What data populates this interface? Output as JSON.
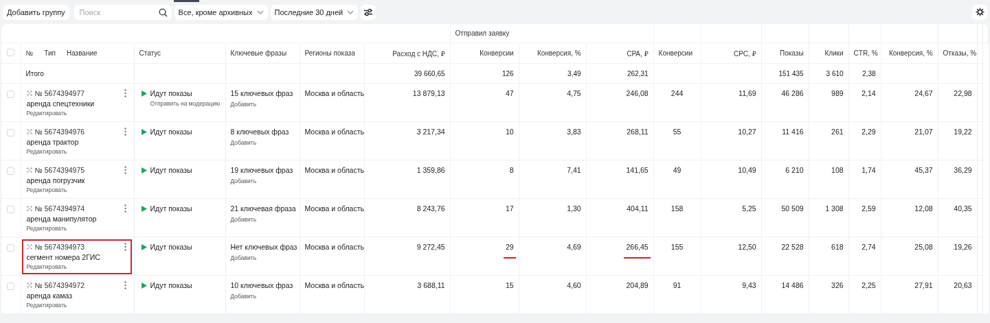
{
  "toolbar": {
    "add_button": "Добавить группу",
    "search": {
      "placeholder": "Поиск"
    },
    "filters": [
      {
        "label": "Все, кроме архивных"
      },
      {
        "label": "Последние 30 дней"
      }
    ]
  },
  "table": {
    "group_header": {
      "label": "Отправил заявку"
    },
    "select_all": {
      "checked": false
    },
    "name_header": {
      "number": "№",
      "type": "Тип",
      "name": "Название"
    },
    "columns": [
      {
        "label": "Статус"
      },
      {
        "label": "Ключевые фразы"
      },
      {
        "label": "Регионы показа"
      },
      {
        "label": "Расход с НДС, ₽",
        "total": "39 660,65"
      },
      {
        "label": "Конверсии",
        "total": "126"
      },
      {
        "label": "Конверсия, %",
        "total": "3,49"
      },
      {
        "label": "CPA, ₽",
        "total": "262,31"
      },
      {
        "label": "Конверсии"
      },
      {
        "label": "CPC, ₽"
      },
      {
        "label": "Показы",
        "total": "151 435"
      },
      {
        "label": "Клики",
        "total": "3 610"
      },
      {
        "label": "CTR, %",
        "total": "2,38"
      },
      {
        "label": "Конверсия, %"
      },
      {
        "label": "Отказы, %"
      }
    ],
    "total_label": "Итого",
    "rows": [
      {
        "checked": false,
        "highlighted": false,
        "number": "№ 5674394977",
        "name": "аренда спецтехники",
        "edit": "Редактировать",
        "status": "Идут показы",
        "status_action": "Отправить на модерацию",
        "keywords": "15 ключевых фраз",
        "add": "Добавить",
        "region": "Москва и область",
        "values": [
          {
            "text": "13 879,13",
            "underlined": false
          },
          {
            "text": "47",
            "underlined": false
          },
          {
            "text": "4,75",
            "underlined": false
          },
          {
            "text": "246,08",
            "underlined": false
          },
          {
            "text": "244",
            "underlined": false
          },
          {
            "text": "11,69",
            "underlined": false
          },
          {
            "text": "46 286",
            "underlined": false
          },
          {
            "text": "989",
            "underlined": false
          },
          {
            "text": "2,14",
            "underlined": false
          },
          {
            "text": "24,67",
            "underlined": false
          },
          {
            "text": "22,98",
            "underlined": false
          }
        ]
      },
      {
        "checked": false,
        "highlighted": false,
        "number": "№ 5674394976",
        "name": "аренда трактор",
        "edit": "Редактировать",
        "status": "Идут показы",
        "keywords": "8 ключевых фраз",
        "add": "Добавить",
        "region": "Москва и область",
        "values": [
          {
            "text": "3 217,34",
            "underlined": false
          },
          {
            "text": "10",
            "underlined": false
          },
          {
            "text": "3,83",
            "underlined": false
          },
          {
            "text": "268,11",
            "underlined": false
          },
          {
            "text": "55",
            "underlined": false
          },
          {
            "text": "10,27",
            "underlined": false
          },
          {
            "text": "11 416",
            "underlined": false
          },
          {
            "text": "261",
            "underlined": false
          },
          {
            "text": "2,29",
            "underlined": false
          },
          {
            "text": "21,07",
            "underlined": false
          },
          {
            "text": "19,22",
            "underlined": false
          }
        ]
      },
      {
        "checked": false,
        "highlighted": false,
        "number": "№ 5674394975",
        "name": "аренда погрузчик",
        "edit": "Редактировать",
        "status": "Идут показы",
        "keywords": "19 ключевых фраз",
        "add": "Добавить",
        "region": "Москва и область",
        "values": [
          {
            "text": "1 359,86",
            "underlined": false
          },
          {
            "text": "8",
            "underlined": false
          },
          {
            "text": "7,41",
            "underlined": false
          },
          {
            "text": "141,65",
            "underlined": false
          },
          {
            "text": "49",
            "underlined": false
          },
          {
            "text": "10,49",
            "underlined": false
          },
          {
            "text": "6 210",
            "underlined": false
          },
          {
            "text": "108",
            "underlined": false
          },
          {
            "text": "1,74",
            "underlined": false
          },
          {
            "text": "45,37",
            "underlined": false
          },
          {
            "text": "36,29",
            "underlined": false
          }
        ]
      },
      {
        "checked": false,
        "highlighted": false,
        "number": "№ 5674394974",
        "name": "аренда манипулятор",
        "edit": "Редактировать",
        "status": "Идут показы",
        "keywords": "21 ключевая фраза",
        "add": "Добавить",
        "region": "Москва и область",
        "values": [
          {
            "text": "8 243,76",
            "underlined": false
          },
          {
            "text": "17",
            "underlined": false
          },
          {
            "text": "1,30",
            "underlined": false
          },
          {
            "text": "404,11",
            "underlined": false
          },
          {
            "text": "158",
            "underlined": false
          },
          {
            "text": "5,25",
            "underlined": false
          },
          {
            "text": "50 509",
            "underlined": false
          },
          {
            "text": "1 308",
            "underlined": false
          },
          {
            "text": "2,59",
            "underlined": false
          },
          {
            "text": "12,08",
            "underlined": false
          },
          {
            "text": "40,35",
            "underlined": false
          }
        ]
      },
      {
        "checked": false,
        "highlighted": true,
        "number": "№ 5674394973",
        "name": "сегмент номера 2ГИС",
        "edit": "Редактировать",
        "status": "Идут показы",
        "keywords": "Нет ключевых фраз",
        "add": "Добавить",
        "region": "Москва и область",
        "values": [
          {
            "text": "9 272,45",
            "underlined": false
          },
          {
            "text": "29",
            "underlined": true
          },
          {
            "text": "4,69",
            "underlined": false
          },
          {
            "text": "266,45",
            "underlined": true
          },
          {
            "text": "155",
            "underlined": false
          },
          {
            "text": "12,50",
            "underlined": false
          },
          {
            "text": "22 528",
            "underlined": false
          },
          {
            "text": "618",
            "underlined": false
          },
          {
            "text": "2,74",
            "underlined": false
          },
          {
            "text": "25,08",
            "underlined": false
          },
          {
            "text": "19,26",
            "underlined": false
          }
        ]
      },
      {
        "checked": false,
        "highlighted": false,
        "number": "№ 5674394972",
        "name": "аренда камаз",
        "edit": "Редактировать",
        "status": "Идут показы",
        "keywords": "10 ключевых фраз",
        "add": "Добавить",
        "region": "Москва и область",
        "values": [
          {
            "text": "3 688,11",
            "underlined": false
          },
          {
            "text": "15",
            "underlined": false
          },
          {
            "text": "4,60",
            "underlined": false
          },
          {
            "text": "204,89",
            "underlined": false
          },
          {
            "text": "91",
            "underlined": false
          },
          {
            "text": "9,43",
            "underlined": false
          },
          {
            "text": "14 486",
            "underlined": false
          },
          {
            "text": "326",
            "underlined": false
          },
          {
            "text": "2,25",
            "underlined": false
          },
          {
            "text": "27,91",
            "underlined": false
          },
          {
            "text": "20,63",
            "underlined": false
          }
        ]
      }
    ]
  }
}
